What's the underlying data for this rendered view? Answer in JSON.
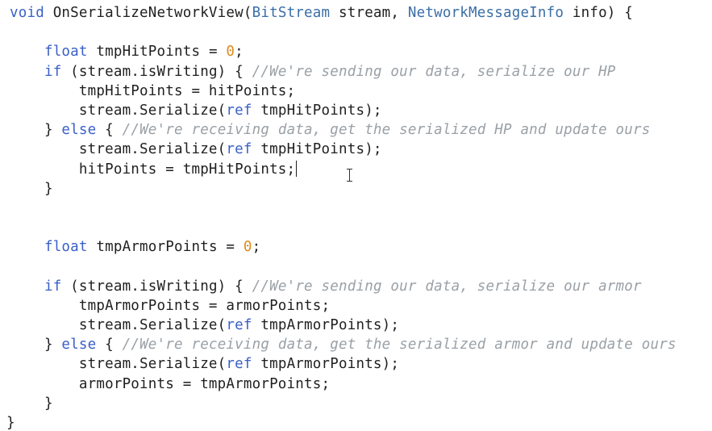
{
  "editor": {
    "lines": [
      [
        {
          "t": "void",
          "c": "kw"
        },
        {
          "t": " OnSerializeNetworkView(",
          "c": "plain"
        },
        {
          "t": "BitStream",
          "c": "type"
        },
        {
          "t": " stream, ",
          "c": "plain"
        },
        {
          "t": "NetworkMessageInfo",
          "c": "type"
        },
        {
          "t": " info) {",
          "c": "plain"
        }
      ],
      [],
      [
        {
          "t": "    ",
          "c": "plain"
        },
        {
          "t": "float",
          "c": "kw"
        },
        {
          "t": " tmpHitPoints = ",
          "c": "plain"
        },
        {
          "t": "0",
          "c": "num"
        },
        {
          "t": ";",
          "c": "plain"
        }
      ],
      [
        {
          "t": "    ",
          "c": "plain"
        },
        {
          "t": "if",
          "c": "kw"
        },
        {
          "t": " (stream.isWriting) { ",
          "c": "plain"
        },
        {
          "t": "//We're sending our data, serialize our HP",
          "c": "cmt"
        }
      ],
      [
        {
          "t": "        tmpHitPoints = hitPoints;",
          "c": "plain"
        }
      ],
      [
        {
          "t": "        stream.Serialize(",
          "c": "plain"
        },
        {
          "t": "ref",
          "c": "kw"
        },
        {
          "t": " tmpHitPoints);",
          "c": "plain"
        }
      ],
      [
        {
          "t": "    } ",
          "c": "plain"
        },
        {
          "t": "else",
          "c": "kw"
        },
        {
          "t": " { ",
          "c": "plain"
        },
        {
          "t": "//We're receiving data, get the serialized HP and update ours",
          "c": "cmt"
        }
      ],
      [
        {
          "t": "        stream.Serialize(",
          "c": "plain"
        },
        {
          "t": "ref",
          "c": "kw"
        },
        {
          "t": " tmpHitPoints);",
          "c": "plain"
        }
      ],
      [
        {
          "t": "        hitPoints = tmpHitPoints;",
          "c": "plain",
          "caret": true
        }
      ],
      [
        {
          "t": "    }",
          "c": "plain"
        }
      ],
      [],
      [],
      [
        {
          "t": "    ",
          "c": "plain"
        },
        {
          "t": "float",
          "c": "kw"
        },
        {
          "t": " tmpArmorPoints = ",
          "c": "plain"
        },
        {
          "t": "0",
          "c": "num"
        },
        {
          "t": ";",
          "c": "plain"
        }
      ],
      [],
      [
        {
          "t": "    ",
          "c": "plain"
        },
        {
          "t": "if",
          "c": "kw"
        },
        {
          "t": " (stream.isWriting) { ",
          "c": "plain"
        },
        {
          "t": "//We're sending our data, serialize our armor",
          "c": "cmt"
        }
      ],
      [
        {
          "t": "        tmpArmorPoints = armorPoints;",
          "c": "plain"
        }
      ],
      [
        {
          "t": "        stream.Serialize(",
          "c": "plain"
        },
        {
          "t": "ref",
          "c": "kw"
        },
        {
          "t": " tmpArmorPoints);",
          "c": "plain"
        }
      ],
      [
        {
          "t": "    } ",
          "c": "plain"
        },
        {
          "t": "else",
          "c": "kw"
        },
        {
          "t": " { ",
          "c": "plain"
        },
        {
          "t": "//We're receiving data, get the serialized armor and update ours",
          "c": "cmt"
        }
      ],
      [
        {
          "t": "        stream.Serialize(",
          "c": "plain"
        },
        {
          "t": "ref",
          "c": "kw"
        },
        {
          "t": " tmpArmorPoints);",
          "c": "plain"
        }
      ],
      [
        {
          "t": "        armorPoints = tmpArmorPoints;",
          "c": "plain"
        }
      ],
      [
        {
          "t": "    }",
          "c": "plain"
        }
      ]
    ],
    "closing_brace": "}"
  },
  "colors": {
    "keyword": "#3a5fc8",
    "type": "#3a6ea8",
    "number": "#e08a1e",
    "comment": "#9aa0a6",
    "text": "#1f1f1f",
    "background": "#ffffff"
  },
  "icons": {
    "mouse_cursor": "ibeam-cursor-icon"
  }
}
